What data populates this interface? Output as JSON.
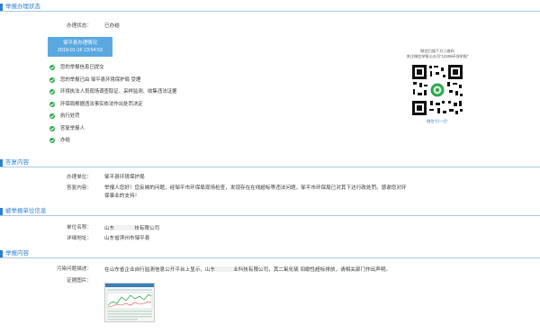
{
  "sections": {
    "status_title": "举报办理状态",
    "reply_title": "答复内容",
    "reported_title": "被举报单位信息",
    "report_title": "举报内容"
  },
  "status": {
    "label": "办理状态：",
    "value": "已办结",
    "card_title": "邹平县办理情况",
    "card_time": "2019-01-16 13:54:53",
    "steps": [
      "您的举报信息已提交",
      "您的举报已由 邹平县环境保护局 受理",
      "环境执法人员现场调查取证、采样监测、收集违法证据",
      "环保局根据违法事实依法作出处罚决定",
      "执行处罚",
      "答复举报人",
      "办结"
    ],
    "step_color": "#2fa84f"
  },
  "qr": {
    "caption_line1": "微信扫描下方二维码",
    "caption_line2": "关注微信举报公众号“12369环保举报”",
    "caption_bottom": "微信“扫一扫”"
  },
  "reply": {
    "unit_label": "办理单位：",
    "unit_value": "邹平县环境保护局",
    "content_label": "答复内容：",
    "content_line1": "举报人您好！您反映的问题，经邹平市环保局现场检查，发现存在在线超标等违法问题，邹平市环保局已对其下达行政处罚。感谢您对环",
    "content_line2": "保事业的支持！"
  },
  "reported": {
    "name_label": "单位名称：",
    "name_prefix": "山东",
    "name_suffix": "技有限公司",
    "addr_label": "详细地址：",
    "addr_value": "山东省滨州市邹平县"
  },
  "report": {
    "desc_label": "污染问题描述：",
    "desc_part1": "在山东省企业自行监测信息公开平台上显示，山东",
    "desc_part2": "业科技有限公司，其二氧化硫 间歇性超标排放，请相关部门作出声明。",
    "evidence_label": "证据图片："
  },
  "colors": {
    "accent": "#2e7fd0",
    "card_bg": "#5aa8e0"
  }
}
